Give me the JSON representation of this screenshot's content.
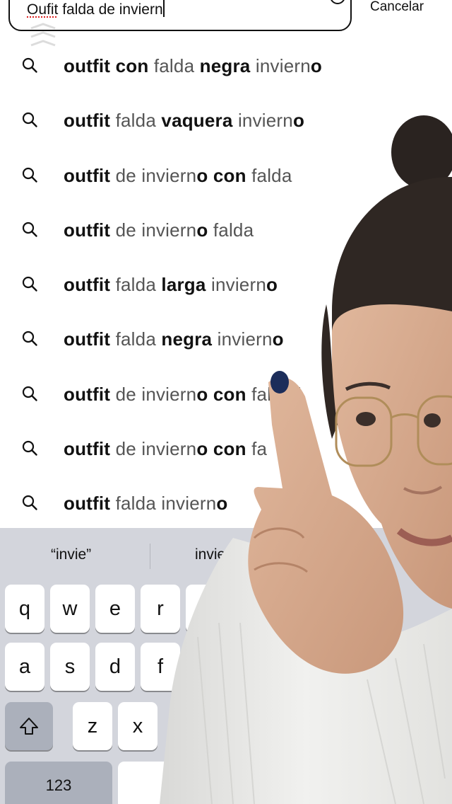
{
  "search": {
    "value_typo": "Oufit",
    "value_rest": " falda de inviern",
    "cancel_label": "Cancelar"
  },
  "suggestions": [
    {
      "parts": [
        {
          "t": "outfit con",
          "b": true
        },
        {
          "t": " falda ",
          "b": false
        },
        {
          "t": "negra",
          "b": true
        },
        {
          "t": " inviern",
          "b": false
        },
        {
          "t": "o",
          "b": true
        }
      ]
    },
    {
      "parts": [
        {
          "t": "outfit",
          "b": true
        },
        {
          "t": " falda ",
          "b": false
        },
        {
          "t": "vaquera",
          "b": true
        },
        {
          "t": " inviern",
          "b": false
        },
        {
          "t": "o",
          "b": true
        }
      ]
    },
    {
      "parts": [
        {
          "t": "outfit",
          "b": true
        },
        {
          "t": " de inviern",
          "b": false
        },
        {
          "t": "o con",
          "b": true
        },
        {
          "t": " falda",
          "b": false
        }
      ]
    },
    {
      "parts": [
        {
          "t": "outfit",
          "b": true
        },
        {
          "t": " de inviern",
          "b": false
        },
        {
          "t": "o",
          "b": true
        },
        {
          "t": " falda",
          "b": false
        }
      ]
    },
    {
      "parts": [
        {
          "t": "outfit",
          "b": true
        },
        {
          "t": " falda ",
          "b": false
        },
        {
          "t": "larga",
          "b": true
        },
        {
          "t": " inviern",
          "b": false
        },
        {
          "t": "o",
          "b": true
        }
      ]
    },
    {
      "parts": [
        {
          "t": "outfit",
          "b": true
        },
        {
          "t": " falda ",
          "b": false
        },
        {
          "t": "negra",
          "b": true
        },
        {
          "t": " inviern",
          "b": false
        },
        {
          "t": "o",
          "b": true
        }
      ]
    },
    {
      "parts": [
        {
          "t": "outfit",
          "b": true
        },
        {
          "t": " de inviern",
          "b": false
        },
        {
          "t": "o con",
          "b": true
        },
        {
          "t": " falda l",
          "b": false
        }
      ]
    },
    {
      "parts": [
        {
          "t": "outfit",
          "b": true
        },
        {
          "t": " de inviern",
          "b": false
        },
        {
          "t": "o con",
          "b": true
        },
        {
          "t": " fa",
          "b": false
        }
      ]
    },
    {
      "parts": [
        {
          "t": "outfit",
          "b": true
        },
        {
          "t": " falda inviern",
          "b": false
        },
        {
          "t": "o",
          "b": true
        }
      ]
    }
  ],
  "keyboard": {
    "predictions": [
      "“invie”",
      "invie"
    ],
    "row1": [
      "q",
      "w",
      "e",
      "r",
      "t"
    ],
    "row2": [
      "a",
      "s",
      "d",
      "f"
    ],
    "row3": [
      "z",
      "x"
    ],
    "numbers_label": "123"
  },
  "icons": {
    "clear": "circle-x-icon",
    "suggestion": "search-icon",
    "shift": "shift-arrow-icon"
  },
  "colors": {
    "keyboard_bg": "#d3d5dc",
    "key_bg": "#ffffff",
    "key_dark_bg": "#abb0bb",
    "text_bold": "#111111",
    "text_light": "#555555"
  }
}
